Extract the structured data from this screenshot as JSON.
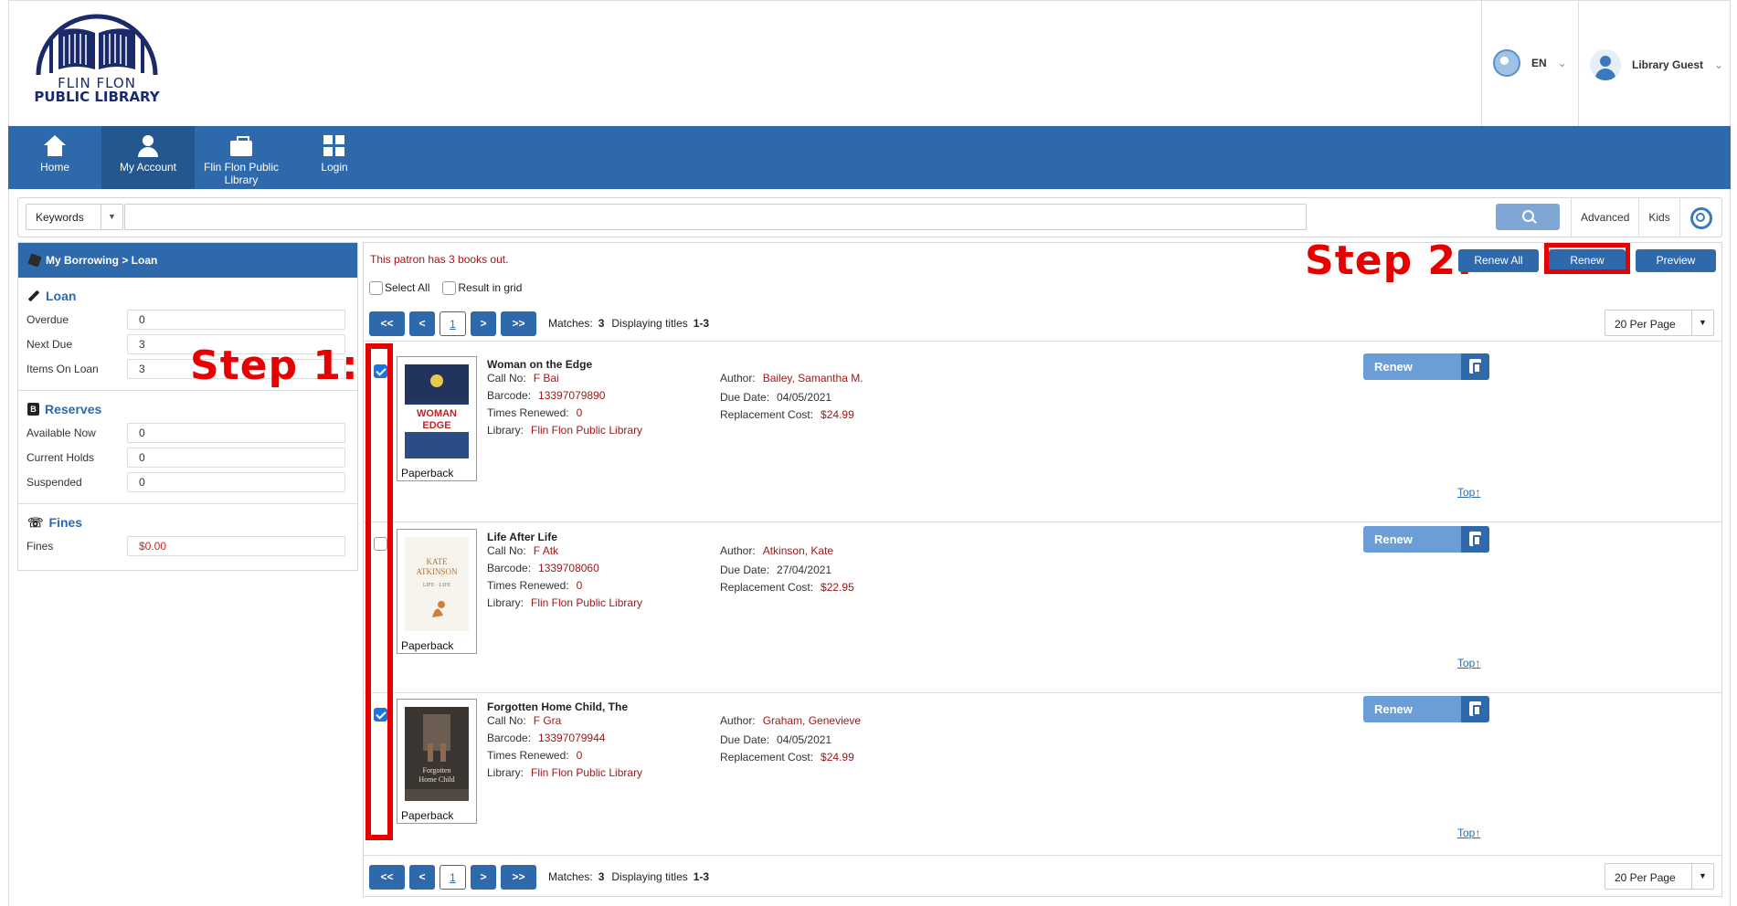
{
  "header": {
    "logo": {
      "line1": "FLIN FLON",
      "line2": "PUBLIC LIBRARY"
    },
    "language": {
      "label": "EN"
    },
    "user": {
      "label": "Library Guest"
    }
  },
  "nav": {
    "items": [
      {
        "label": "Home",
        "icon": "home-icon"
      },
      {
        "label": "My Account",
        "icon": "user-icon"
      },
      {
        "label": "Flin Flon Public Library",
        "icon": "briefcase-icon"
      },
      {
        "label": "Login",
        "icon": "grid-icon"
      }
    ]
  },
  "search": {
    "type_label": "Keywords",
    "query": "",
    "links": [
      "Advanced",
      "Kids"
    ]
  },
  "sidebar": {
    "heading": "My Borrowing > Loan",
    "loan": {
      "title": "Loan",
      "fields": [
        {
          "label": "Overdue",
          "value": "0"
        },
        {
          "label": "Next Due",
          "value": "3"
        },
        {
          "label": "Items On Loan",
          "value": "3"
        }
      ]
    },
    "reserves": {
      "title": "Reserves",
      "fields": [
        {
          "label": "Available Now",
          "value": "0"
        },
        {
          "label": "Current Holds",
          "value": "0"
        },
        {
          "label": "Suspended",
          "value": "0"
        }
      ]
    },
    "fines": {
      "title": "Fines",
      "fields": [
        {
          "label": "Fines",
          "value": "$0.00"
        }
      ]
    }
  },
  "results": {
    "patron_message": "This patron has 3 books out.",
    "buttons": {
      "renew_all": "Renew All",
      "renew": "Renew",
      "preview": "Preview"
    },
    "select_all": "Select All",
    "result_in_grid": "Result in grid",
    "pager": {
      "first": "<<",
      "prev": "<",
      "current": "1",
      "next": ">",
      "last": ">>",
      "matches_label": "Matches:",
      "matches": "3",
      "displaying_label": "Displaying titles",
      "range": "1-3",
      "per_page": "20 Per Page"
    },
    "items": [
      {
        "title": "Woman on the Edge",
        "checked": true,
        "format": "Paperback",
        "call_no": "F Bai",
        "barcode": "13397079890",
        "times_renewed": "0",
        "library": "Flin Flon Public Library",
        "author": "Bailey, Samantha M.",
        "due_date": "04/05/2021",
        "replacement_cost": "$24.99",
        "cover_text": "WOMAN ON THE EDGE",
        "renew_label": "Renew",
        "top_label": "Top↑"
      },
      {
        "title": "Life After Life",
        "checked": false,
        "format": "Paperback",
        "call_no": "F Atk",
        "barcode": "1339708060",
        "times_renewed": "0",
        "library": "Flin Flon Public Library",
        "author": "Atkinson, Kate",
        "due_date": "27/04/2021",
        "replacement_cost": "$22.95",
        "cover_text": "KATE ATKINSON",
        "renew_label": "Renew",
        "top_label": "Top↑"
      },
      {
        "title": "Forgotten Home Child, The",
        "checked": true,
        "format": "Paperback",
        "call_no": "F Gra",
        "barcode": "13397079944",
        "times_renewed": "0",
        "library": "Flin Flon Public Library",
        "author": "Graham, Genevieve",
        "due_date": "04/05/2021",
        "replacement_cost": "$24.99",
        "cover_text": "The Forgotten Home Child",
        "renew_label": "Renew",
        "top_label": "Top↑"
      }
    ],
    "labels": {
      "call_no": "Call No:",
      "barcode": "Barcode:",
      "times_renewed": "Times Renewed:",
      "library": "Library:",
      "author": "Author:",
      "due_date": "Due Date:",
      "replacement_cost": "Replacement Cost:"
    }
  },
  "annotations": {
    "step1": "Step 1:",
    "step2": "Step 2:"
  },
  "colors": {
    "primary": "#2e6aab",
    "highlight": "#e60000",
    "accent_text": "#a01818"
  }
}
